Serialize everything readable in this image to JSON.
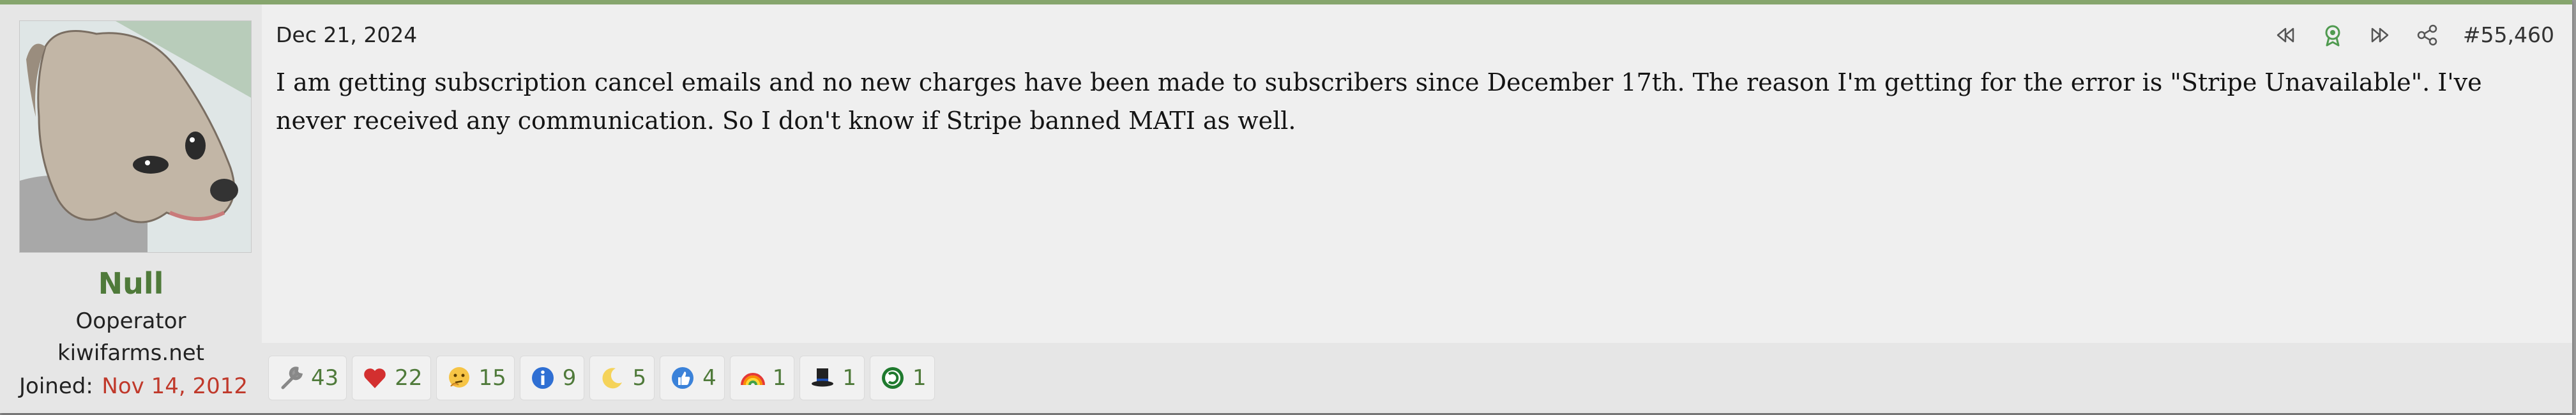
{
  "user": {
    "name": "Null",
    "title": "Ooperator",
    "banner": "kiwifarms.net",
    "joined_label": "Joined:",
    "joined_date": "Nov 14, 2012",
    "avatar_icon": "dog-avatar"
  },
  "post": {
    "date": "Dec 21, 2024",
    "number": "#55,460",
    "body": "I am getting subscription cancel emails and no new charges have been made to subscribers since December 17th. The reason I'm getting for the error is \"Stripe Unavailable\". I've never received any communication. So I don't know if Stripe banned MATI as well."
  },
  "actions": {
    "icons": [
      "rewind-icon",
      "ribbon-icon",
      "fast-forward-icon",
      "share-icon"
    ]
  },
  "reactions": [
    {
      "icon": "wrench-icon",
      "count": "43"
    },
    {
      "icon": "heart-icon",
      "count": "22"
    },
    {
      "icon": "thinking-face-icon",
      "count": "15"
    },
    {
      "icon": "info-icon",
      "count": "9"
    },
    {
      "icon": "moon-icon",
      "count": "5"
    },
    {
      "icon": "thumbs-up-icon",
      "count": "4"
    },
    {
      "icon": "rainbow-icon",
      "count": "1"
    },
    {
      "icon": "top-hat-icon",
      "count": "1"
    },
    {
      "icon": "copyleft-icon",
      "count": "1"
    }
  ],
  "colors": {
    "accent": "#86a56d",
    "username": "#4f7a3a",
    "joined_date": "#c0392b",
    "reaction_count": "#4f7a3a"
  }
}
